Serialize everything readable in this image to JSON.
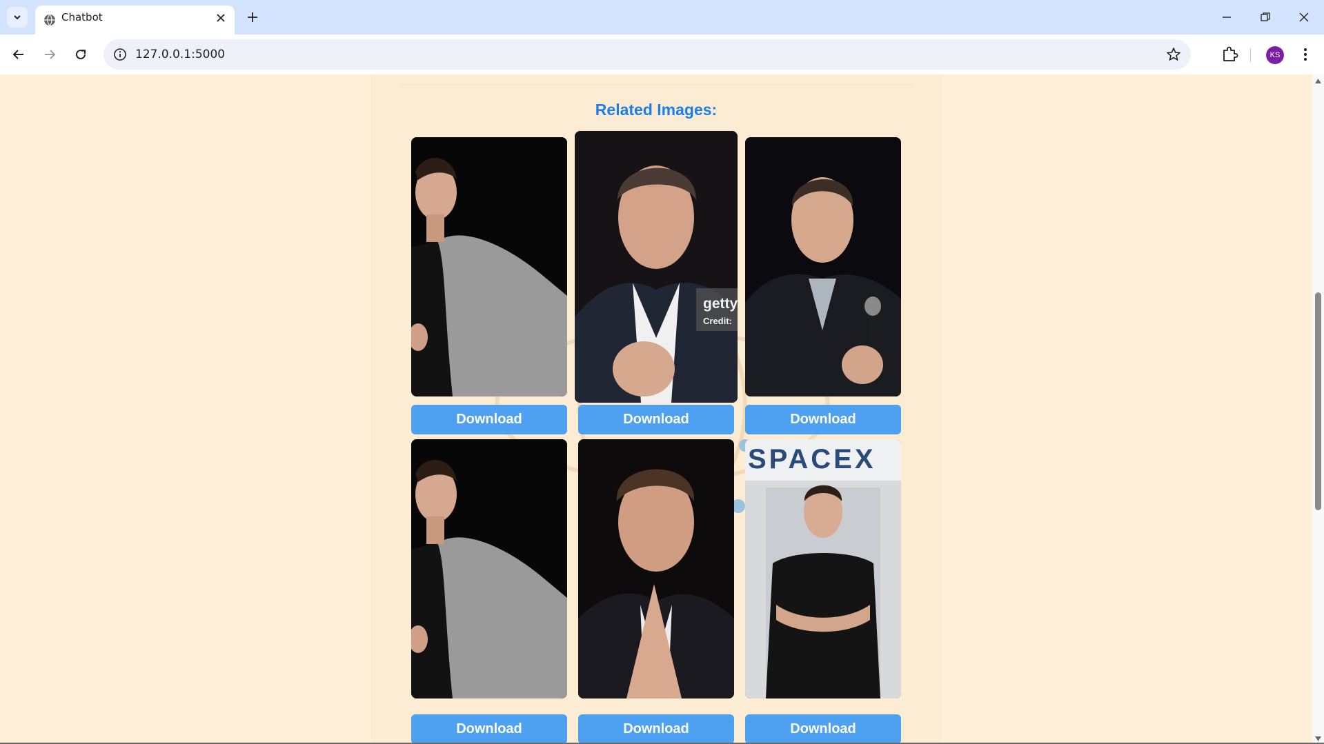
{
  "browser": {
    "tab_title": "Chatbot",
    "url": "127.0.0.1:5000",
    "profile_initials": "KS"
  },
  "page": {
    "heading": "Related Images:",
    "images": [
      {
        "alt": "Man in grey blazer gesturing, black background",
        "download_label": "Download"
      },
      {
        "alt": "Man with hands clasped, watermark getty Credit:",
        "watermark": "getty",
        "watermark_credit": "Credit:",
        "download_label": "Download"
      },
      {
        "alt": "Man smiling holding microphone",
        "download_label": "Download"
      },
      {
        "alt": "Man in grey blazer gesturing, black background",
        "download_label": "Download"
      },
      {
        "alt": "Man with fingertips pressed together",
        "download_label": "Download"
      },
      {
        "alt": "Man with crossed arms in front of capsule",
        "backdrop_text": "SPACEX",
        "download_label": "Download"
      }
    ]
  },
  "colors": {
    "page_bg": "#fdefd8",
    "heading": "#1a7ee8",
    "button_bg": "#4ea0f0",
    "tabbar_bg": "#d3e3fd",
    "avatar_bg": "#7b1fa2"
  }
}
